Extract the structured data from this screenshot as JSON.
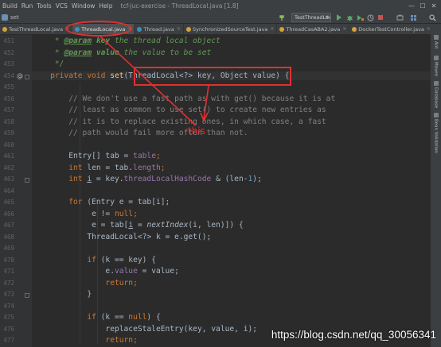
{
  "menubar": {
    "items": [
      "Build",
      "Run",
      "Tools",
      "VCS",
      "Window",
      "Help"
    ],
    "window_title": "tcf-juc-exercise - ThreadLocal.java [1.8]",
    "controls": {
      "minimize": "—",
      "maximize": "☐",
      "close": "✕"
    }
  },
  "toolbar": {
    "breadcrumb": "set",
    "run_config": "TestThreadLocal",
    "icons": [
      "run-icon",
      "debug-icon",
      "coverage-icon",
      "profile-icon",
      "stop-icon",
      "build-icon",
      "search-icon"
    ]
  },
  "tabs": [
    {
      "label": "TestThreadLocal.java",
      "active": false,
      "icon": "class-icon"
    },
    {
      "label": "ThreadLocal.java",
      "active": true,
      "icon": "class-icon"
    },
    {
      "label": "Thread.java",
      "active": false,
      "icon": "class-icon"
    },
    {
      "label": "SynchronizedSourceTest.java",
      "active": false,
      "icon": "class-icon"
    },
    {
      "label": "ThreadCasABA2.java",
      "active": false,
      "icon": "class-icon"
    },
    {
      "label": "DockerTestController.java",
      "active": false,
      "icon": "class-icon"
    }
  ],
  "tabs_overflow": "≡",
  "tab_close": "×",
  "line_numbers": [
    "451",
    "452",
    "453",
    "454",
    "455",
    "456",
    "457",
    "458",
    "459",
    "460",
    "461",
    "462",
    "463",
    "464",
    "465",
    "466",
    "467",
    "468",
    "469",
    "470",
    "471",
    "472",
    "473",
    "474",
    "475",
    "476",
    "477",
    "478",
    "479",
    "480",
    "481"
  ],
  "gutter_marks": {
    "override": "@"
  },
  "code": {
    "javadoc_param_tag": "@param",
    "l451": {
      "name": "key",
      "desc": " the thread local object"
    },
    "l452": {
      "name": "value",
      "desc": " the value to be set"
    },
    "l453": "*/",
    "l454": {
      "mods": "private void ",
      "method": "set",
      "params": "(ThreadLocal<?> key, Object value) {"
    },
    "l456": "// We don't use a fast path as with get() because it is at",
    "l457": "// least as common to use set() to create new entries as",
    "l458": "// it is to replace existing ones, in which case, a fast",
    "l459": "// path would fail more often than not.",
    "l461": {
      "type": "Entry[] tab = ",
      "field": "table",
      "end": ";"
    },
    "l462": {
      "kw": "int ",
      "name": "len = tab.",
      "field": "length",
      "end": ";"
    },
    "l463": {
      "kw": "int ",
      "var": "i",
      "mid": " = key.",
      "field": "threadLocalHashCode",
      "op": " & (len-",
      "num": "1",
      "end": ");"
    },
    "l465": {
      "kw": "for ",
      "rest": "(Entry e = tab[i];"
    },
    "l466": {
      "pre": "e != ",
      "kw": "null",
      "end": ";"
    },
    "l467": {
      "pre": "e = tab[",
      "var": "i",
      "mid": " = ",
      "call": "nextIndex",
      "args": "(i, len)]) {"
    },
    "l468": "ThreadLocal<?> k = e.get();",
    "l470": {
      "kw": "if ",
      "rest": "(k == key) {"
    },
    "l471": {
      "pre": "e.",
      "field": "value",
      "end": " = value;"
    },
    "l472": {
      "kw": "return",
      "end": ";"
    },
    "l473": "}",
    "l475": {
      "kw": "if ",
      "pre": "(k == ",
      "kw2": "null",
      "end": ") {"
    },
    "l476": "replaceStaleEntry(key, value, i);",
    "l477": {
      "kw": "return",
      "end": ";"
    }
  },
  "annotation": {
    "label": "this"
  },
  "right_panel": [
    "Ant",
    "Maven",
    "Database",
    "Bean Validation"
  ],
  "watermark": "https://blog.csdn.net/qq_30056341",
  "colors": {
    "background": "#2b2b2b",
    "keyword": "#cc7832",
    "field": "#9876aa",
    "comment": "#808080",
    "javadoc": "#629755",
    "annotation": "#e03030"
  }
}
